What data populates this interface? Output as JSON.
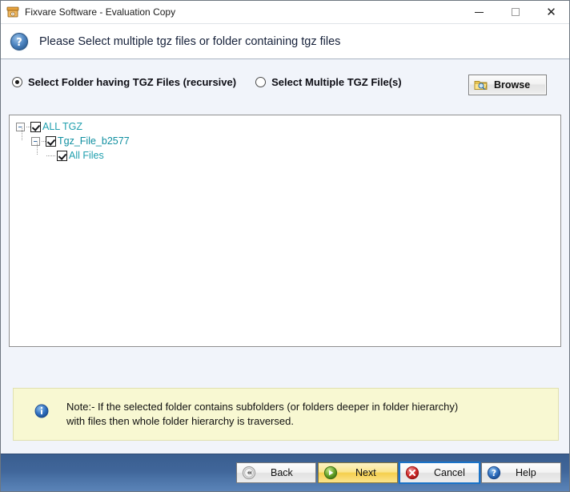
{
  "window": {
    "title": "Fixvare Software - Evaluation Copy",
    "app_icon": "archive-box-icon",
    "controls": {
      "minimize": "minimize-icon",
      "maximize": "maximize-icon",
      "close": "close-icon"
    }
  },
  "header": {
    "icon": "question-mark-icon",
    "instruction": "Please Select multiple tgz files or folder containing tgz files"
  },
  "options": {
    "folder_mode": {
      "label": "Select Folder having TGZ Files (recursive)",
      "selected": true
    },
    "files_mode": {
      "label": "Select Multiple TGZ File(s)",
      "selected": false
    },
    "browse": {
      "label": "Browse",
      "icon": "folder-search-icon"
    }
  },
  "tree": {
    "nodes": [
      {
        "label": "ALL TGZ",
        "level": 0,
        "checked": true,
        "expanded": true
      },
      {
        "label": "Tgz_File_b2577",
        "level": 1,
        "checked": true,
        "expanded": true
      },
      {
        "label": "All Files",
        "level": 2,
        "checked": true,
        "expanded": false
      }
    ]
  },
  "note": {
    "icon": "info-icon",
    "text": "Note:- If the selected folder contains subfolders (or folders deeper in folder hierarchy)\n with files then whole folder hierarchy is traversed."
  },
  "footer": {
    "buttons": [
      {
        "label": "Back",
        "icon": "rewind-icon",
        "style": "normal",
        "focused": false
      },
      {
        "label": "Next",
        "icon": "play-icon",
        "style": "next",
        "focused": false
      },
      {
        "label": "Cancel",
        "icon": "cancel-icon",
        "style": "normal",
        "focused": true
      },
      {
        "label": "Help",
        "icon": "help-icon",
        "style": "normal",
        "focused": false
      }
    ]
  },
  "colors": {
    "body_background": "#f1f4fa",
    "tree_text": "#1f9fae",
    "note_background": "#f8f8d2",
    "footer_gradient_top": "#3a5e8f",
    "footer_gradient_bottom": "#5b84b8",
    "next_button": "#f5cf4d",
    "focus_outline": "#1a73c8"
  }
}
